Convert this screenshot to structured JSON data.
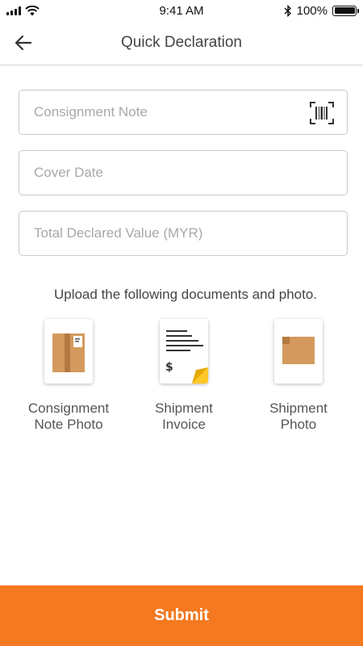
{
  "status_bar": {
    "time": "9:41 AM",
    "battery": "100%",
    "battery_level": 1.0
  },
  "header": {
    "title": "Quick Declaration"
  },
  "form": {
    "consignment_note": {
      "placeholder": "Consignment Note",
      "value": ""
    },
    "cover_date": {
      "placeholder": "Cover Date",
      "value": ""
    },
    "total_declared_value": {
      "placeholder": "Total Declared Value (MYR)",
      "value": ""
    }
  },
  "upload": {
    "instruction": "Upload the following documents and photo.",
    "items": [
      {
        "line1": "Consignment",
        "line2": "Note Photo",
        "icon": "parcel-label-icon"
      },
      {
        "line1": "Shipment",
        "line2": "Invoice",
        "icon": "invoice-icon"
      },
      {
        "line1": "Shipment",
        "line2": "Photo",
        "icon": "box-icon"
      }
    ]
  },
  "submit_label": "Submit",
  "colors": {
    "accent": "#f47920",
    "box": "#d49a5d",
    "box_dark": "#b47940",
    "invoice_corner": "#ffc727"
  }
}
